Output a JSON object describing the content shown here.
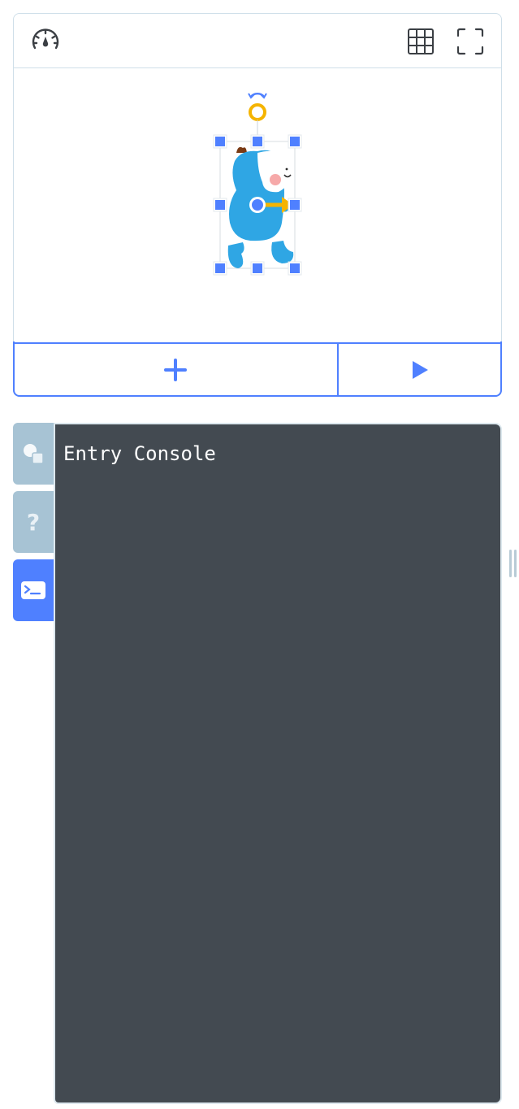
{
  "stage": {
    "header": {
      "speed_icon": "speedometer-icon",
      "grid_icon": "grid-icon",
      "fullscreen_icon": "fullscreen-icon"
    },
    "sprite": {
      "name": "entry-bot-sprite",
      "colors": {
        "body": "#2fa6e4",
        "face": "#ffffff",
        "cheek": "#f6a9a9",
        "hair": "#7a3a14",
        "handle": "#4f80ff",
        "rotate_ring": "#f5b400",
        "direction_arrow": "#f5b400"
      }
    },
    "controls": {
      "add_icon": "plus-icon",
      "play_icon": "play-icon"
    }
  },
  "sidebar": {
    "tabs": [
      {
        "id": "object",
        "icon": "object-shapes-icon",
        "active": false
      },
      {
        "id": "help",
        "icon": "question-mark-icon",
        "label": "?",
        "active": false
      },
      {
        "id": "console",
        "icon": "terminal-icon",
        "active": true
      }
    ]
  },
  "console": {
    "text": "Entry Console"
  },
  "colors": {
    "accent": "#4f80ff",
    "border": "#cfdfe9",
    "tab_inactive": "#a7c3d4",
    "console_bg": "#434a51",
    "console_text": "#ffffff"
  }
}
